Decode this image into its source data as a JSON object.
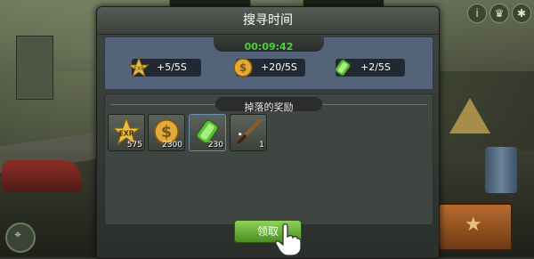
{
  "dialog": {
    "title": "搜寻时间",
    "timer": "00:09:42",
    "rates": [
      {
        "icon": "exp-star-icon",
        "label": "+5/5S"
      },
      {
        "icon": "coin-icon",
        "label": "+20/5S"
      },
      {
        "icon": "battery-icon",
        "label": "+2/5S"
      }
    ],
    "rewards_title": "掉落的奖励",
    "rewards": [
      {
        "icon": "exp-star-icon",
        "count": "575",
        "selected": false
      },
      {
        "icon": "coin-icon",
        "count": "2300",
        "selected": false
      },
      {
        "icon": "battery-icon",
        "count": "230",
        "selected": true
      },
      {
        "icon": "bat-weapon-icon",
        "count": "1",
        "selected": false
      }
    ],
    "claim_button": "领取"
  },
  "icon_labels": {
    "exp": "EXP",
    "coin": "$"
  },
  "colors": {
    "timer": "#4cd13b",
    "claim_button": "#6fb43b",
    "panel_blue": "#52637a"
  }
}
